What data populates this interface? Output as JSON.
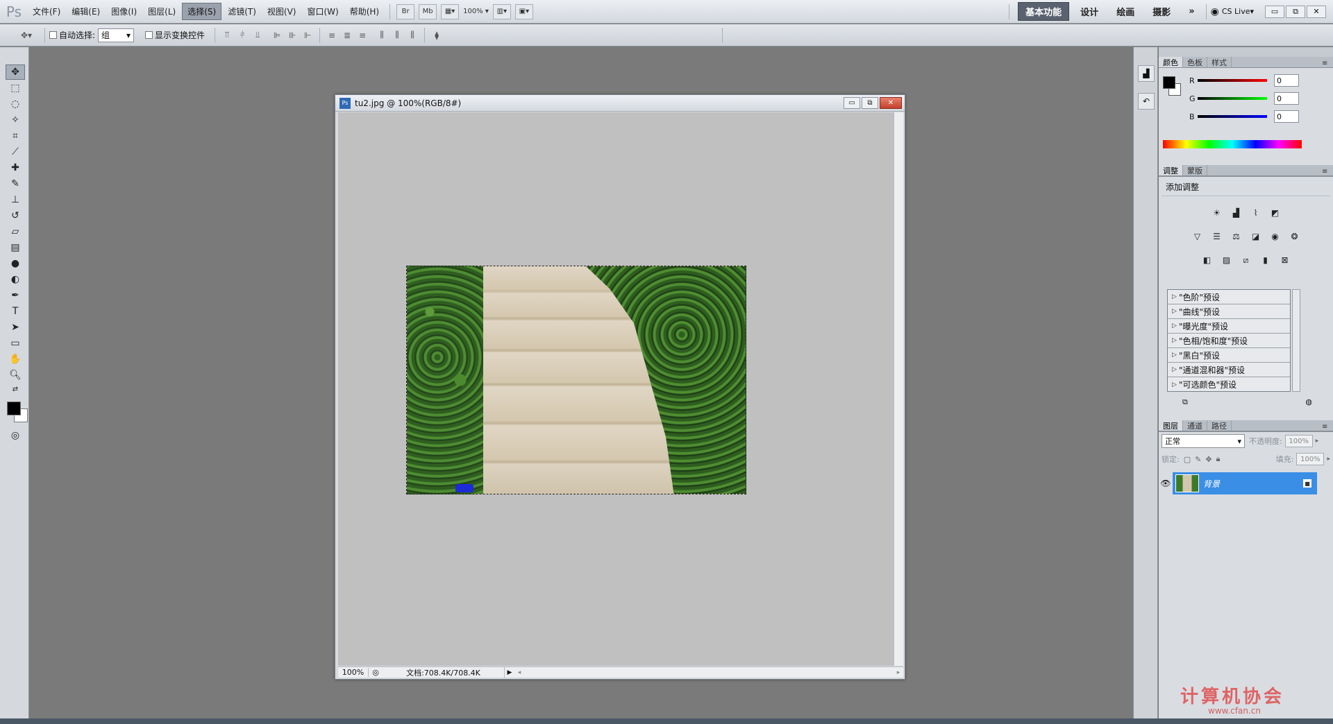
{
  "menubar": {
    "logo": "Ps",
    "menus": [
      "文件(F)",
      "编辑(E)",
      "图像(I)",
      "图层(L)",
      "选择(S)",
      "滤镜(T)",
      "视图(V)",
      "窗口(W)",
      "帮助(H)"
    ],
    "active_menu": "选择(S)",
    "bridge": "Br",
    "minibridge": "Mb",
    "zoom": "100%",
    "workspaces": [
      "基本功能",
      "设计",
      "绘画",
      "摄影"
    ],
    "active_workspace": "基本功能",
    "more": "»",
    "cslive": "CS Live",
    "window_controls": [
      "▭",
      "⧉",
      "✕"
    ]
  },
  "optionsbar": {
    "auto_select_label": "自动选择:",
    "auto_select_value": "组",
    "show_transform_label": "显示变换控件"
  },
  "document": {
    "title": "tu2.jpg @ 100%(RGB/8#)",
    "zoom": "100%",
    "info": "文档:708.4K/708.4K"
  },
  "color_panel": {
    "tabs": [
      "颜色",
      "色板",
      "样式"
    ],
    "sliders": [
      {
        "label": "R",
        "value": "0",
        "color": "#ff0000"
      },
      {
        "label": "G",
        "value": "0",
        "color": "#00ff00"
      },
      {
        "label": "B",
        "value": "0",
        "color": "#0000ff"
      }
    ]
  },
  "adjust_panel": {
    "tabs": [
      "调整",
      "蒙版"
    ],
    "title": "添加调整",
    "presets": [
      "\"色阶\"预设",
      "\"曲线\"预设",
      "\"曝光度\"预设",
      "\"色相/饱和度\"预设",
      "\"黑白\"预设",
      "\"通道混和器\"预设",
      "\"可选颜色\"预设"
    ]
  },
  "layers_panel": {
    "tabs": [
      "图层",
      "通道",
      "路径"
    ],
    "blend_mode": "正常",
    "opacity_label": "不透明度:",
    "opacity": "100%",
    "lock_label": "锁定:",
    "fill_label": "填充:",
    "fill": "100%",
    "layer_name": "背景"
  },
  "watermark": {
    "text": "计算机协会",
    "url": "www.cfan.cn"
  }
}
